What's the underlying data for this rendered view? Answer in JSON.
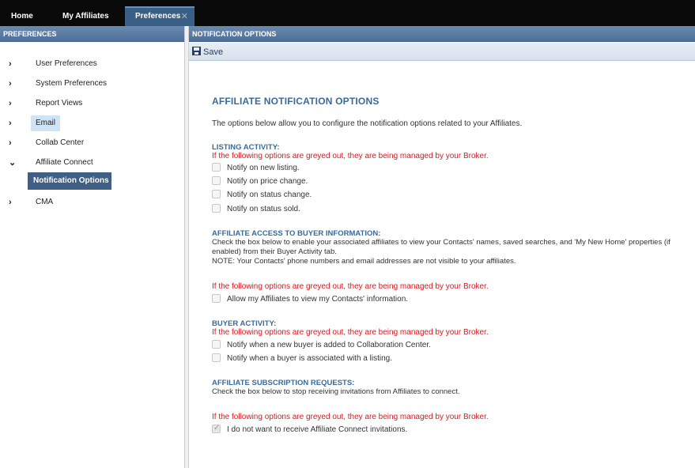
{
  "tabs": {
    "home": "Home",
    "affiliates": "My Affiliates",
    "preferences": "Preferences",
    "close_glyph": "✕"
  },
  "left_panel": {
    "header": "PREFERENCES",
    "items": [
      {
        "label": "User Preferences",
        "chevron": "›"
      },
      {
        "label": "System Preferences",
        "chevron": "›"
      },
      {
        "label": "Report Views",
        "chevron": "›"
      },
      {
        "label": "Email",
        "chevron": "›"
      },
      {
        "label": "Collab Center",
        "chevron": "›"
      },
      {
        "label": "Affiliate Connect",
        "chevron": "⌄"
      },
      {
        "label": "CMA",
        "chevron": "›"
      }
    ],
    "sub_item": "Notification Options"
  },
  "right_panel": {
    "header": "NOTIFICATION OPTIONS",
    "save_label": "Save",
    "title": "AFFILIATE NOTIFICATION OPTIONS",
    "intro": "The options below allow you to configure the notification options related to your Affiliates.",
    "broker_warning": "If the following options are greyed out, they are being managed by your Broker.",
    "listing": {
      "heading": "LISTING ACTIVITY:",
      "options": [
        "Notify on new listing.",
        "Notify on price change.",
        "Notify on status change.",
        "Notify on status sold."
      ]
    },
    "buyer_info": {
      "heading": "AFFILIATE ACCESS TO BUYER INFORMATION:",
      "desc1": "Check the box below to enable your associated affiliates to view your Contacts' names, saved searches, and 'My New Home' properties (if enabled) from their Buyer Activity tab.",
      "desc2": "NOTE: Your Contacts' phone numbers and email addresses are not visible to your affiliates.",
      "option": "Allow my Affiliates to view my Contacts' information."
    },
    "buyer_activity": {
      "heading": "BUYER ACTIVITY:",
      "options": [
        "Notify when a new buyer is added to Collaboration Center.",
        "Notify when a buyer is associated with a listing."
      ]
    },
    "subscription": {
      "heading": "AFFILIATE SUBSCRIPTION REQUESTS:",
      "desc": "Check the box below to stop receiving invitations from Affiliates to connect.",
      "option": "I do not want to receive Affiliate Connect invitations."
    }
  }
}
